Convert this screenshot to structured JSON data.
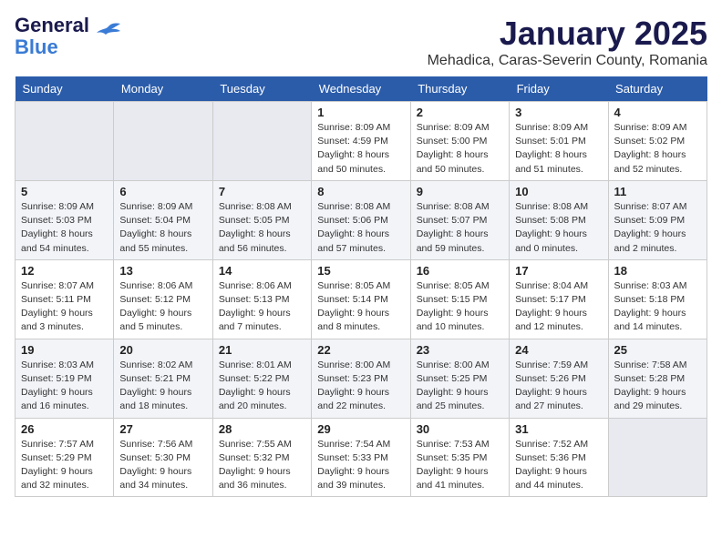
{
  "header": {
    "logo_line1": "General",
    "logo_line2": "Blue",
    "month": "January 2025",
    "location": "Mehadica, Caras-Severin County, Romania"
  },
  "weekdays": [
    "Sunday",
    "Monday",
    "Tuesday",
    "Wednesday",
    "Thursday",
    "Friday",
    "Saturday"
  ],
  "weeks": [
    [
      {
        "day": "",
        "info": ""
      },
      {
        "day": "",
        "info": ""
      },
      {
        "day": "",
        "info": ""
      },
      {
        "day": "1",
        "info": "Sunrise: 8:09 AM\nSunset: 4:59 PM\nDaylight: 8 hours\nand 50 minutes."
      },
      {
        "day": "2",
        "info": "Sunrise: 8:09 AM\nSunset: 5:00 PM\nDaylight: 8 hours\nand 50 minutes."
      },
      {
        "day": "3",
        "info": "Sunrise: 8:09 AM\nSunset: 5:01 PM\nDaylight: 8 hours\nand 51 minutes."
      },
      {
        "day": "4",
        "info": "Sunrise: 8:09 AM\nSunset: 5:02 PM\nDaylight: 8 hours\nand 52 minutes."
      }
    ],
    [
      {
        "day": "5",
        "info": "Sunrise: 8:09 AM\nSunset: 5:03 PM\nDaylight: 8 hours\nand 54 minutes."
      },
      {
        "day": "6",
        "info": "Sunrise: 8:09 AM\nSunset: 5:04 PM\nDaylight: 8 hours\nand 55 minutes."
      },
      {
        "day": "7",
        "info": "Sunrise: 8:08 AM\nSunset: 5:05 PM\nDaylight: 8 hours\nand 56 minutes."
      },
      {
        "day": "8",
        "info": "Sunrise: 8:08 AM\nSunset: 5:06 PM\nDaylight: 8 hours\nand 57 minutes."
      },
      {
        "day": "9",
        "info": "Sunrise: 8:08 AM\nSunset: 5:07 PM\nDaylight: 8 hours\nand 59 minutes."
      },
      {
        "day": "10",
        "info": "Sunrise: 8:08 AM\nSunset: 5:08 PM\nDaylight: 9 hours\nand 0 minutes."
      },
      {
        "day": "11",
        "info": "Sunrise: 8:07 AM\nSunset: 5:09 PM\nDaylight: 9 hours\nand 2 minutes."
      }
    ],
    [
      {
        "day": "12",
        "info": "Sunrise: 8:07 AM\nSunset: 5:11 PM\nDaylight: 9 hours\nand 3 minutes."
      },
      {
        "day": "13",
        "info": "Sunrise: 8:06 AM\nSunset: 5:12 PM\nDaylight: 9 hours\nand 5 minutes."
      },
      {
        "day": "14",
        "info": "Sunrise: 8:06 AM\nSunset: 5:13 PM\nDaylight: 9 hours\nand 7 minutes."
      },
      {
        "day": "15",
        "info": "Sunrise: 8:05 AM\nSunset: 5:14 PM\nDaylight: 9 hours\nand 8 minutes."
      },
      {
        "day": "16",
        "info": "Sunrise: 8:05 AM\nSunset: 5:15 PM\nDaylight: 9 hours\nand 10 minutes."
      },
      {
        "day": "17",
        "info": "Sunrise: 8:04 AM\nSunset: 5:17 PM\nDaylight: 9 hours\nand 12 minutes."
      },
      {
        "day": "18",
        "info": "Sunrise: 8:03 AM\nSunset: 5:18 PM\nDaylight: 9 hours\nand 14 minutes."
      }
    ],
    [
      {
        "day": "19",
        "info": "Sunrise: 8:03 AM\nSunset: 5:19 PM\nDaylight: 9 hours\nand 16 minutes."
      },
      {
        "day": "20",
        "info": "Sunrise: 8:02 AM\nSunset: 5:21 PM\nDaylight: 9 hours\nand 18 minutes."
      },
      {
        "day": "21",
        "info": "Sunrise: 8:01 AM\nSunset: 5:22 PM\nDaylight: 9 hours\nand 20 minutes."
      },
      {
        "day": "22",
        "info": "Sunrise: 8:00 AM\nSunset: 5:23 PM\nDaylight: 9 hours\nand 22 minutes."
      },
      {
        "day": "23",
        "info": "Sunrise: 8:00 AM\nSunset: 5:25 PM\nDaylight: 9 hours\nand 25 minutes."
      },
      {
        "day": "24",
        "info": "Sunrise: 7:59 AM\nSunset: 5:26 PM\nDaylight: 9 hours\nand 27 minutes."
      },
      {
        "day": "25",
        "info": "Sunrise: 7:58 AM\nSunset: 5:28 PM\nDaylight: 9 hours\nand 29 minutes."
      }
    ],
    [
      {
        "day": "26",
        "info": "Sunrise: 7:57 AM\nSunset: 5:29 PM\nDaylight: 9 hours\nand 32 minutes."
      },
      {
        "day": "27",
        "info": "Sunrise: 7:56 AM\nSunset: 5:30 PM\nDaylight: 9 hours\nand 34 minutes."
      },
      {
        "day": "28",
        "info": "Sunrise: 7:55 AM\nSunset: 5:32 PM\nDaylight: 9 hours\nand 36 minutes."
      },
      {
        "day": "29",
        "info": "Sunrise: 7:54 AM\nSunset: 5:33 PM\nDaylight: 9 hours\nand 39 minutes."
      },
      {
        "day": "30",
        "info": "Sunrise: 7:53 AM\nSunset: 5:35 PM\nDaylight: 9 hours\nand 41 minutes."
      },
      {
        "day": "31",
        "info": "Sunrise: 7:52 AM\nSunset: 5:36 PM\nDaylight: 9 hours\nand 44 minutes."
      },
      {
        "day": "",
        "info": ""
      }
    ]
  ]
}
